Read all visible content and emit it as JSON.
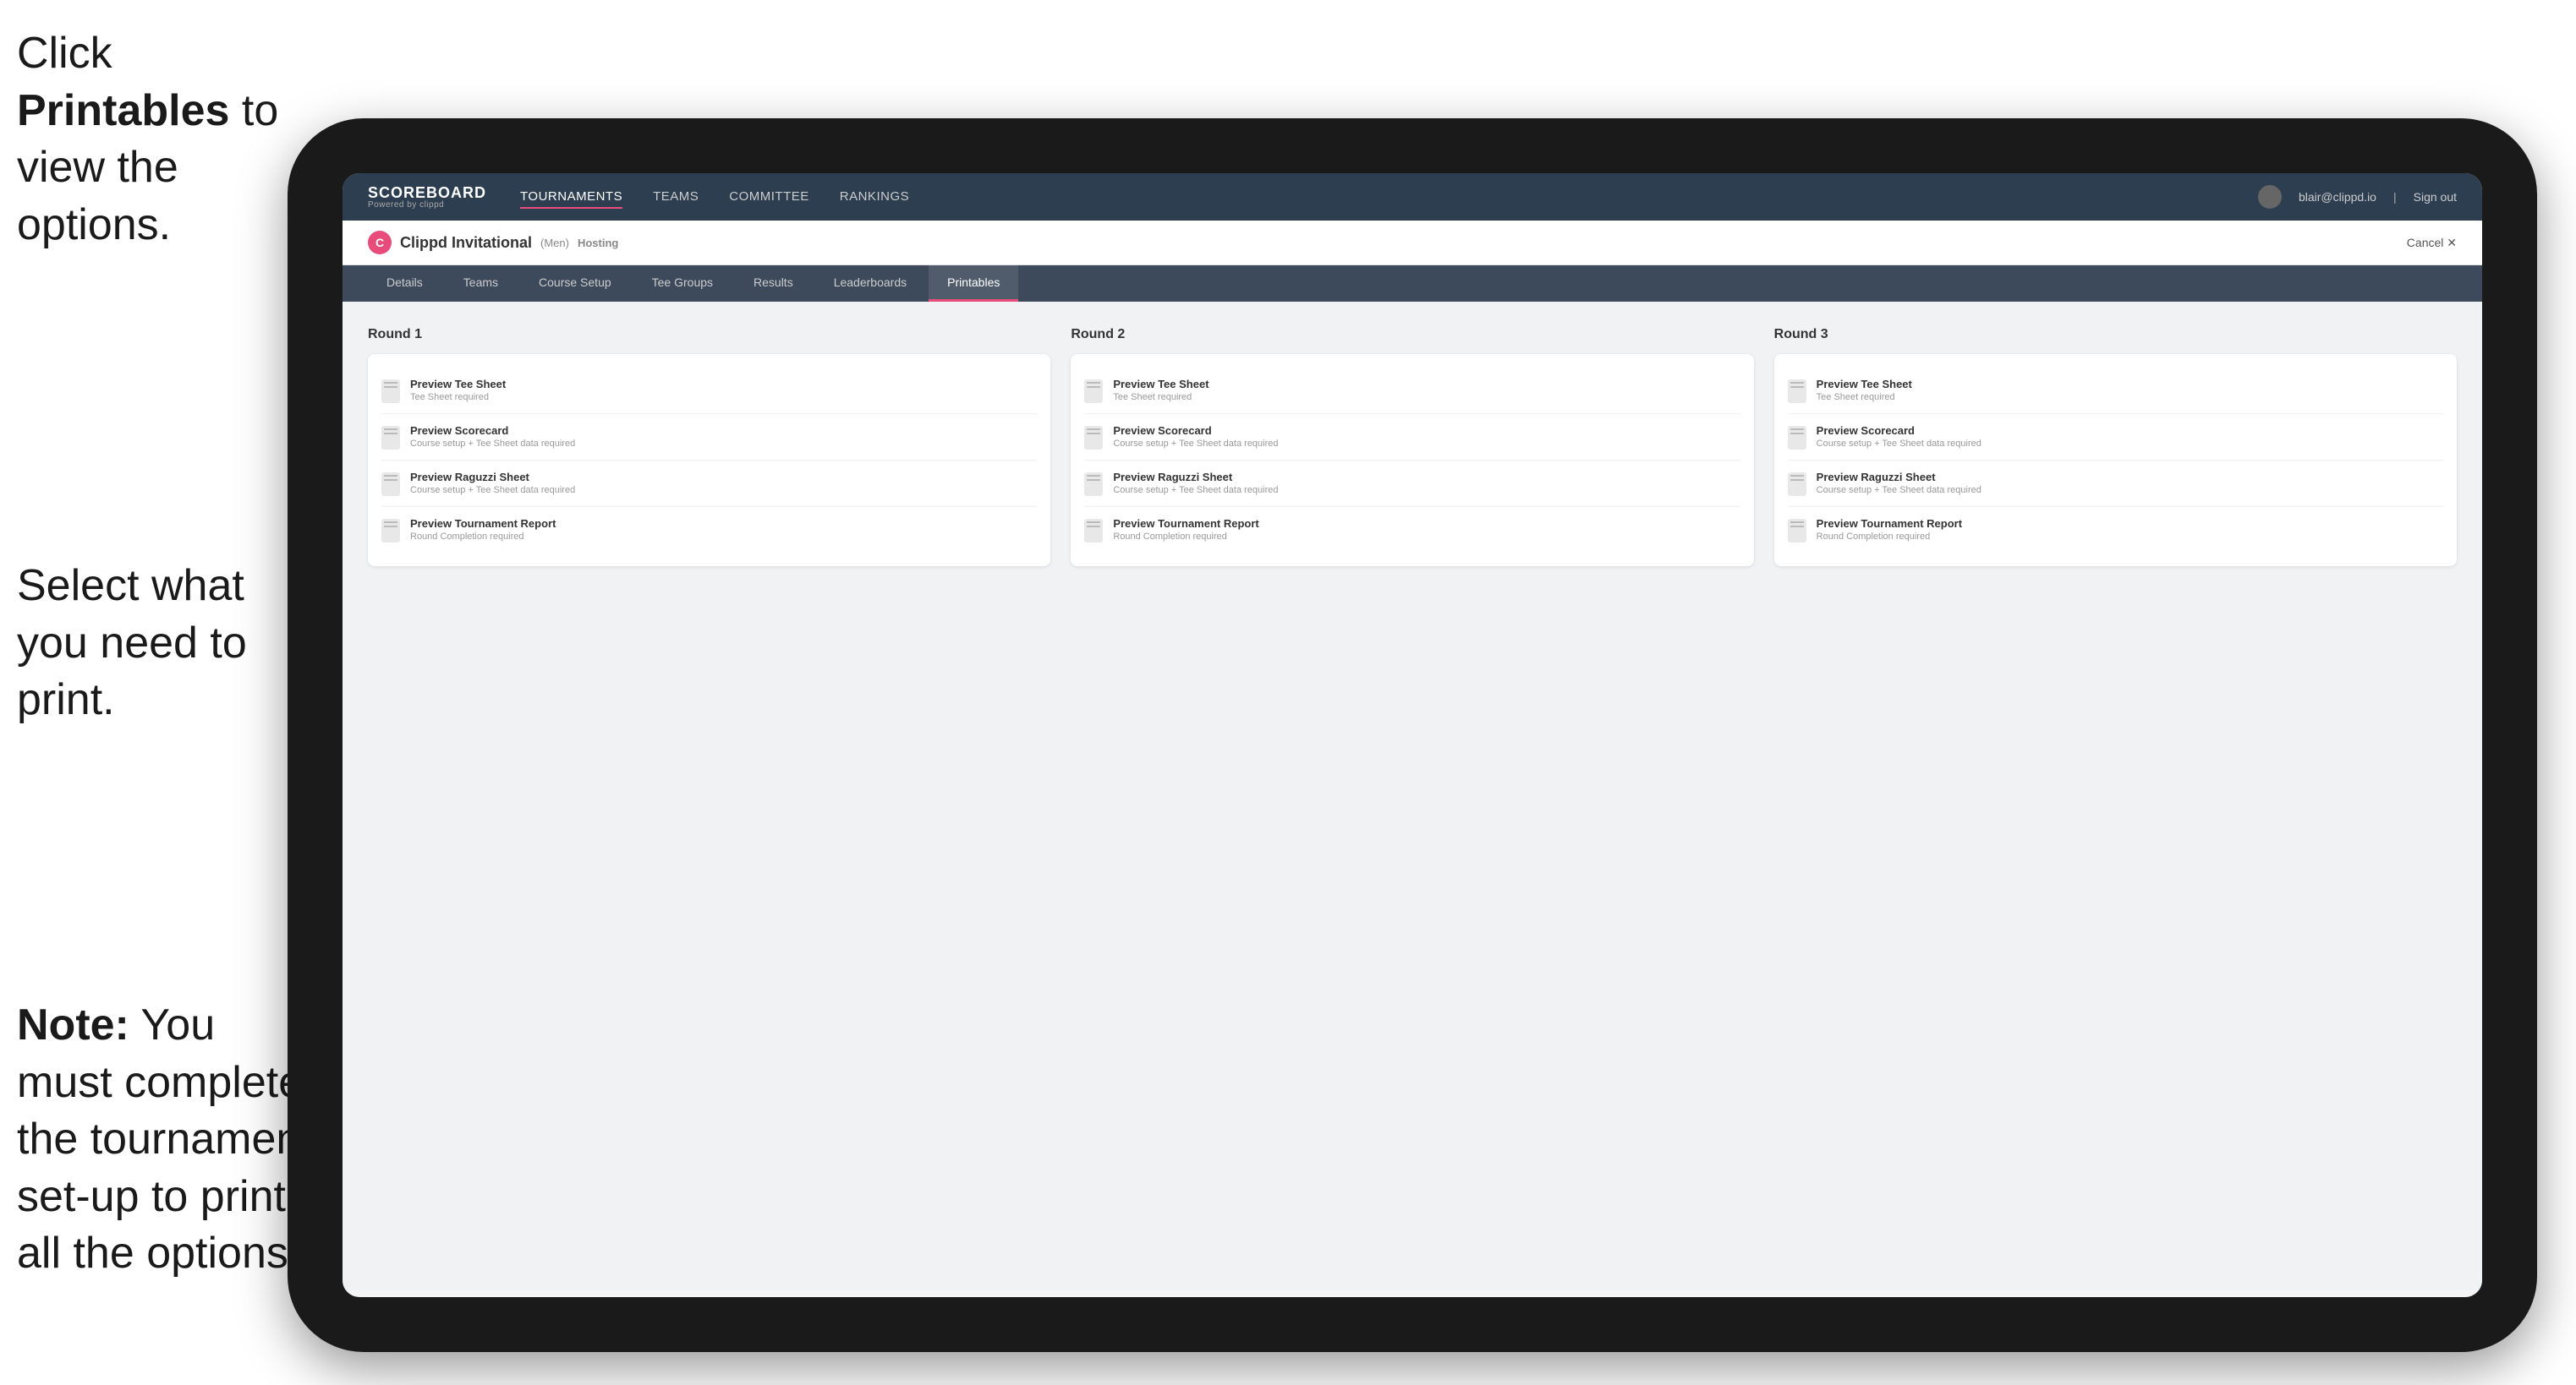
{
  "instructions": {
    "top": "Click ",
    "top_bold": "Printables",
    "top_rest": " to view the options.",
    "middle": "Select what you need to print.",
    "bottom_bold": "Note:",
    "bottom_rest": " You must complete the tournament set-up to print all the options."
  },
  "nav": {
    "brand": "SCOREBOARD",
    "brand_sub": "Powered by clippd",
    "links": [
      "TOURNAMENTS",
      "TEAMS",
      "COMMITTEE",
      "RANKINGS"
    ],
    "active_link": "TOURNAMENTS",
    "user_email": "blair@clippd.io",
    "sign_out": "Sign out"
  },
  "tournament": {
    "name": "Clippd Invitational",
    "badge": "(Men)",
    "status": "Hosting",
    "cancel": "Cancel ✕"
  },
  "tabs": [
    "Details",
    "Teams",
    "Course Setup",
    "Tee Groups",
    "Results",
    "Leaderboards",
    "Printables"
  ],
  "active_tab": "Printables",
  "rounds": [
    {
      "title": "Round 1",
      "items": [
        {
          "title": "Preview Tee Sheet",
          "sub": "Tee Sheet required"
        },
        {
          "title": "Preview Scorecard",
          "sub": "Course setup + Tee Sheet data required"
        },
        {
          "title": "Preview Raguzzi Sheet",
          "sub": "Course setup + Tee Sheet data required"
        },
        {
          "title": "Preview Tournament Report",
          "sub": "Round Completion required"
        }
      ]
    },
    {
      "title": "Round 2",
      "items": [
        {
          "title": "Preview Tee Sheet",
          "sub": "Tee Sheet required"
        },
        {
          "title": "Preview Scorecard",
          "sub": "Course setup + Tee Sheet data required"
        },
        {
          "title": "Preview Raguzzi Sheet",
          "sub": "Course setup + Tee Sheet data required"
        },
        {
          "title": "Preview Tournament Report",
          "sub": "Round Completion required"
        }
      ]
    },
    {
      "title": "Round 3",
      "items": [
        {
          "title": "Preview Tee Sheet",
          "sub": "Tee Sheet required"
        },
        {
          "title": "Preview Scorecard",
          "sub": "Course setup + Tee Sheet data required"
        },
        {
          "title": "Preview Raguzzi Sheet",
          "sub": "Course setup + Tee Sheet data required"
        },
        {
          "title": "Preview Tournament Report",
          "sub": "Round Completion required"
        }
      ]
    }
  ]
}
